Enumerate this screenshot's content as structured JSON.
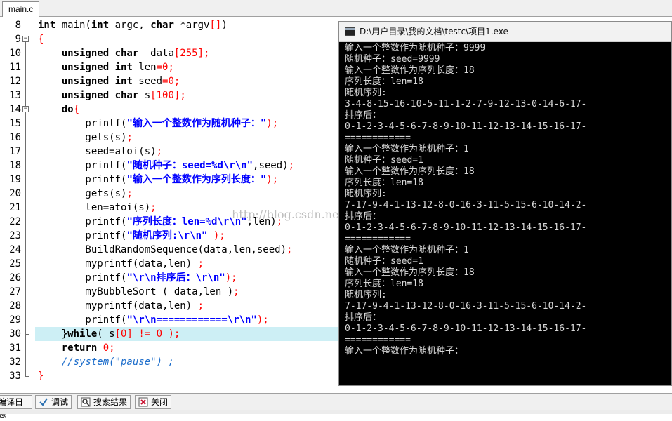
{
  "tab": {
    "label": "main.c"
  },
  "editor": {
    "line_numbers": [
      "8",
      "9",
      "10",
      "11",
      "12",
      "13",
      "14",
      "15",
      "16",
      "17",
      "18",
      "19",
      "20",
      "21",
      "22",
      "23",
      "24",
      "25",
      "26",
      "27",
      "28",
      "29",
      "30",
      "31",
      "32",
      "33"
    ],
    "lines": [
      [
        {
          "t": "int",
          "c": "kw"
        },
        {
          "t": " main("
        },
        {
          "t": "int",
          "c": "kw"
        },
        {
          "t": " argc, "
        },
        {
          "t": "char",
          "c": "kw"
        },
        {
          "t": " *argv"
        },
        {
          "t": "[]",
          "c": "op"
        },
        {
          "t": ")"
        }
      ],
      [
        {
          "t": "{",
          "c": "op"
        }
      ],
      [
        {
          "t": "    "
        },
        {
          "t": "unsigned char",
          "c": "kw"
        },
        {
          "t": "  data"
        },
        {
          "t": "[255]",
          "c": "num"
        },
        {
          "t": ";",
          "c": "op"
        }
      ],
      [
        {
          "t": "    "
        },
        {
          "t": "unsigned int",
          "c": "kw"
        },
        {
          "t": " len"
        },
        {
          "t": "=0",
          "c": "num"
        },
        {
          "t": ";",
          "c": "op"
        }
      ],
      [
        {
          "t": "    "
        },
        {
          "t": "unsigned int",
          "c": "kw"
        },
        {
          "t": " seed"
        },
        {
          "t": "=0",
          "c": "num"
        },
        {
          "t": ";",
          "c": "op"
        }
      ],
      [
        {
          "t": "    "
        },
        {
          "t": "unsigned char",
          "c": "kw"
        },
        {
          "t": " s"
        },
        {
          "t": "[100]",
          "c": "num"
        },
        {
          "t": ";",
          "c": "op"
        }
      ],
      [
        {
          "t": "    "
        },
        {
          "t": "do",
          "c": "kw"
        },
        {
          "t": "{",
          "c": "op"
        }
      ],
      [
        {
          "t": "        printf("
        },
        {
          "t": "\"输入一个整数作为随机种子：\"",
          "c": "str"
        },
        {
          "t": ");",
          "c": "op"
        }
      ],
      [
        {
          "t": "        gets(s)"
        },
        {
          "t": ";",
          "c": "op"
        }
      ],
      [
        {
          "t": "        seed=atoi(s)"
        },
        {
          "t": ";",
          "c": "op"
        }
      ],
      [
        {
          "t": "        printf("
        },
        {
          "t": "\"随机种子：seed=%d\\r\\n\"",
          "c": "str"
        },
        {
          "t": ",seed)"
        },
        {
          "t": ";",
          "c": "op"
        }
      ],
      [
        {
          "t": "        printf("
        },
        {
          "t": "\"输入一个整数作为序列长度：\"",
          "c": "str"
        },
        {
          "t": ");",
          "c": "op"
        }
      ],
      [
        {
          "t": "        gets(s)"
        },
        {
          "t": ";",
          "c": "op"
        }
      ],
      [
        {
          "t": "        len=atoi(s)"
        },
        {
          "t": ";",
          "c": "op"
        }
      ],
      [
        {
          "t": "        printf("
        },
        {
          "t": "\"序列长度：len=%d\\r\\n\"",
          "c": "str"
        },
        {
          "t": ",len)"
        },
        {
          "t": ";",
          "c": "op"
        }
      ],
      [
        {
          "t": "        printf("
        },
        {
          "t": "\"随机序列:\\r\\n\"",
          "c": "str"
        },
        {
          "t": " );",
          "c": "op"
        }
      ],
      [
        {
          "t": "        BuildRandomSequence(data,len,seed)"
        },
        {
          "t": ";",
          "c": "op"
        }
      ],
      [
        {
          "t": "        myprintf(data,len) "
        },
        {
          "t": ";",
          "c": "op"
        }
      ],
      [
        {
          "t": "        printf("
        },
        {
          "t": "\"\\r\\n排序后：\\r\\n\"",
          "c": "str"
        },
        {
          "t": ");",
          "c": "op"
        }
      ],
      [
        {
          "t": "        myBubbleSort ( data,len )"
        },
        {
          "t": ";",
          "c": "op"
        }
      ],
      [
        {
          "t": "        myprintf(data,len) "
        },
        {
          "t": ";",
          "c": "op"
        }
      ],
      [
        {
          "t": "        printf("
        },
        {
          "t": "\"\\r\\n============\\r\\n\"",
          "c": "str"
        },
        {
          "t": ");",
          "c": "op"
        }
      ],
      [
        {
          "t": "    "
        },
        {
          "t": "}while",
          "c": "kw"
        },
        {
          "t": "( s"
        },
        {
          "t": "[0]",
          "c": "num"
        },
        {
          "t": " "
        },
        {
          "t": "!=",
          "c": "op"
        },
        {
          "t": " "
        },
        {
          "t": "0",
          "c": "num"
        },
        {
          "t": " );",
          "c": "op"
        }
      ],
      [
        {
          "t": "    "
        },
        {
          "t": "return",
          "c": "kw"
        },
        {
          "t": " "
        },
        {
          "t": "0",
          "c": "num"
        },
        {
          "t": ";",
          "c": "op"
        }
      ],
      [
        {
          "t": "    "
        },
        {
          "t": "//system(\"pause\") ;",
          "c": "cmt"
        }
      ],
      [
        {
          "t": "}",
          "c": "op"
        }
      ]
    ],
    "highlight_line_index": 22,
    "watermark": "http://blog.csdn.net/wangzibigan"
  },
  "console": {
    "title": "D:\\用户目录\\我的文档\\testc\\项目1.exe",
    "output_lines": [
      "输入一个整数作为随机种子：9999",
      "随机种子：seed=9999",
      "输入一个整数作为序列长度：18",
      "序列长度：len=18",
      "随机序列:",
      "3-4-8-15-16-10-5-11-1-2-7-9-12-13-0-14-6-17-",
      "排序后：",
      "0-1-2-3-4-5-6-7-8-9-10-11-12-13-14-15-16-17-",
      "============",
      "输入一个整数作为随机种子：1",
      "随机种子：seed=1",
      "输入一个整数作为序列长度：18",
      "序列长度：len=18",
      "随机序列:",
      "7-17-9-4-1-13-12-8-0-16-3-11-5-15-6-10-14-2-",
      "排序后：",
      "0-1-2-3-4-5-6-7-8-9-10-11-12-13-14-15-16-17-",
      "============",
      "输入一个整数作为随机种子：1",
      "随机种子：seed=1",
      "输入一个整数作为序列长度：18",
      "序列长度：len=18",
      "随机序列:",
      "7-17-9-4-1-13-12-8-0-16-3-11-5-15-6-10-14-2-",
      "排序后：",
      "0-1-2-3-4-5-6-7-8-9-10-11-12-13-14-15-16-17-",
      "============",
      "输入一个整数作为随机种子："
    ]
  },
  "bottom_tabs": {
    "compile_log": "编译日志",
    "debug": "调试",
    "search_results": "搜索结果",
    "close": "关闭",
    "icons": [
      "check-icon",
      "search-icon",
      "close-icon"
    ]
  }
}
